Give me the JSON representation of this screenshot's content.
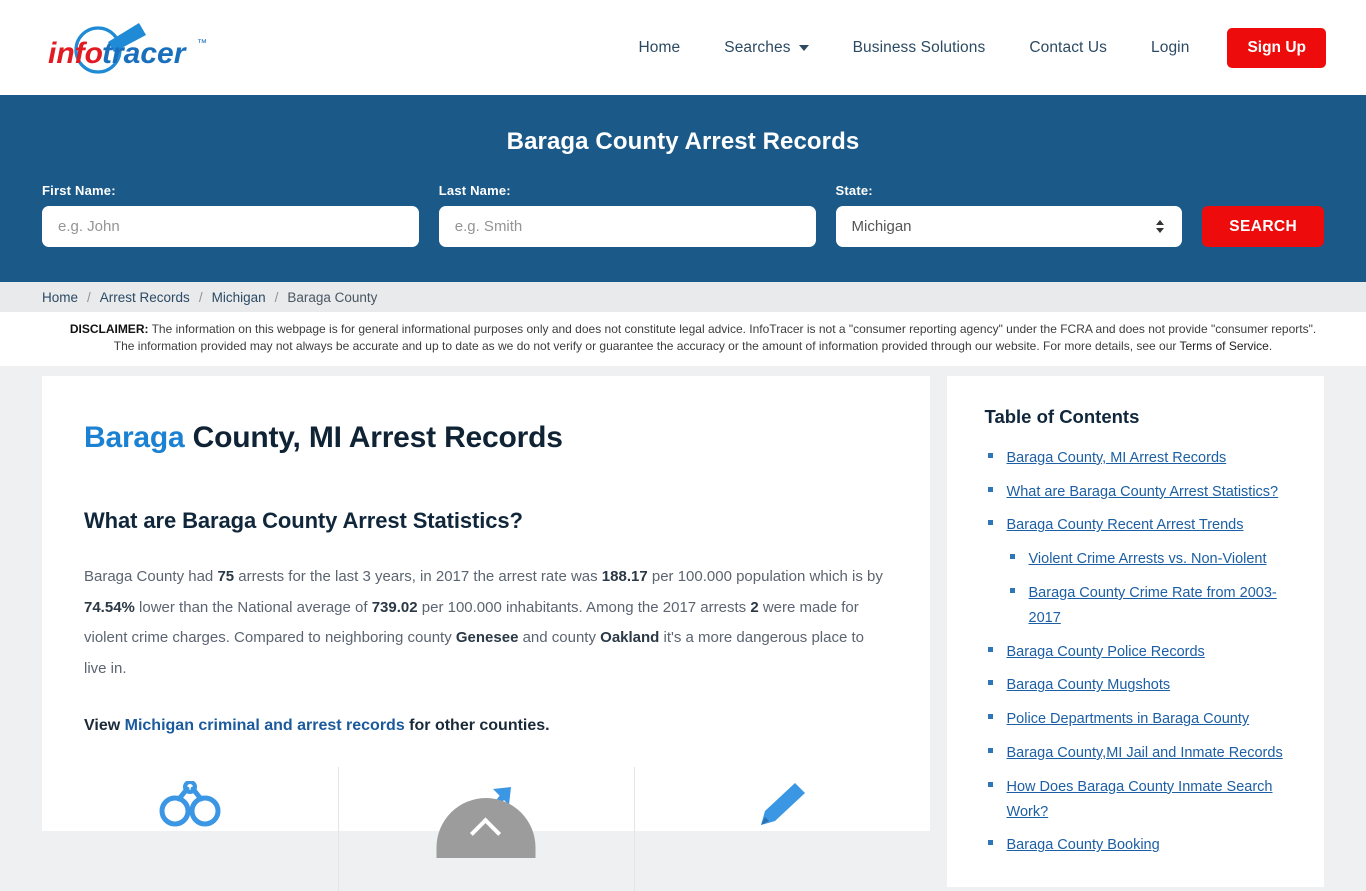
{
  "brand": {
    "name_first": "info",
    "name_second": "tracer",
    "trademark": "™",
    "red": "#e01b22",
    "blue": "#1f8ad6"
  },
  "nav": {
    "items": [
      {
        "label": "Home",
        "caret": false
      },
      {
        "label": "Searches",
        "caret": true
      },
      {
        "label": "Business Solutions",
        "caret": false
      },
      {
        "label": "Contact Us",
        "caret": false
      },
      {
        "label": "Login",
        "caret": false
      }
    ],
    "signup_label": "Sign Up",
    "signup_color": "#ed0b0b"
  },
  "hero": {
    "title": "Baraga County Arrest Records",
    "background": "#1b5a88",
    "first_name_label": "First Name:",
    "first_name_placeholder": "e.g. John",
    "first_name_value": "",
    "last_name_label": "Last Name:",
    "last_name_placeholder": "e.g. Smith",
    "last_name_value": "",
    "state_label": "State:",
    "state_value": "Michigan",
    "search_label": "SEARCH"
  },
  "breadcrumb": {
    "home": "Home",
    "arrest_records": "Arrest Records",
    "state": "Michigan",
    "county": "Baraga County",
    "separator": "/"
  },
  "disclaimer": {
    "label": "DISCLAIMER:",
    "text": " The information on this webpage is for general informational purposes only and does not constitute legal advice. InfoTracer is not a \"consumer reporting agency\" under the FCRA and does not provide \"consumer reports\". The information provided may not always be accurate and up to date as we do not verify or guarantee the accuracy or the amount of information provided through our website. For more details, see our ",
    "link": "Terms of Service",
    "period": "."
  },
  "main": {
    "title_highlight": "Baraga",
    "title_rest": " County, MI Arrest Records",
    "subheading": "What are Baraga County Arrest Statistics?",
    "paragraph": {
      "p1": "Baraga County had ",
      "b1": "75",
      "p2": " arrests for the last 3 years, in 2017 the arrest rate was ",
      "b2": "188.17",
      "p3": " per 100.000 population which is by ",
      "b3": "74.54%",
      "p4": " lower than the National average of ",
      "b4": "739.02",
      "p5": " per 100.000 inhabitants. Among the 2017 arrests ",
      "b5": "2",
      "p6": " were made for violent crime charges. Compared to neighboring county ",
      "b6": "Genesee",
      "p7": " and county ",
      "b7": "Oakland",
      "p8": " it's a more dangerous place to live in."
    },
    "view_prefix": "View ",
    "view_link": "Michigan criminal and arrest records",
    "view_suffix": " for other counties.",
    "icons": [
      "handcuffs-icon",
      "trend-arrow-icon",
      "pen-icon"
    ]
  },
  "sidebar": {
    "title": "Table of Contents",
    "items": [
      {
        "label": "Baraga County, MI Arrest Records",
        "sub": false
      },
      {
        "label": "What are Baraga County Arrest Statistics?",
        "sub": false
      },
      {
        "label": "Baraga County Recent Arrest Trends",
        "sub": false
      },
      {
        "label": "Violent Crime Arrests vs. Non-Violent",
        "sub": true
      },
      {
        "label": "Baraga County Crime Rate from 2003-2017",
        "sub": true
      },
      {
        "label": "Baraga County Police Records",
        "sub": false
      },
      {
        "label": "Baraga County Mugshots",
        "sub": false
      },
      {
        "label": "Police Departments in Baraga County",
        "sub": false
      },
      {
        "label": "Baraga County,MI Jail and Inmate Records",
        "sub": false
      },
      {
        "label": "How Does Baraga County Inmate Search Work?",
        "sub": false
      },
      {
        "label": "Baraga County Booking",
        "sub": false
      }
    ]
  },
  "scroll_top": {
    "name": "scroll-to-top",
    "color": "#9c9c9c"
  }
}
